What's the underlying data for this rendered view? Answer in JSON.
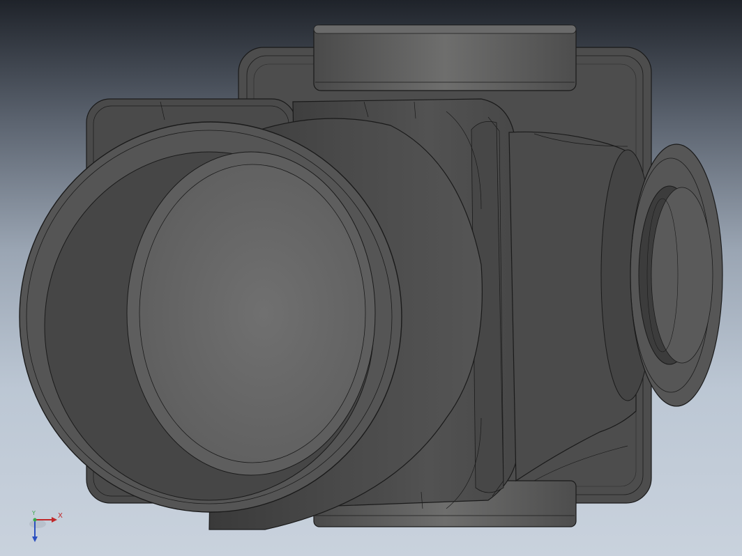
{
  "viewport": {
    "part": "valve-body-3d-model"
  },
  "triad": {
    "x_label": "X",
    "y_label": "Y",
    "x_color": "#c0282a",
    "y_color": "#3aa94a",
    "z_color": "#2a4fc0"
  },
  "colors": {
    "body": "#5b5b5a",
    "body_dark": "#404040",
    "edge": "#1a1a1a"
  }
}
